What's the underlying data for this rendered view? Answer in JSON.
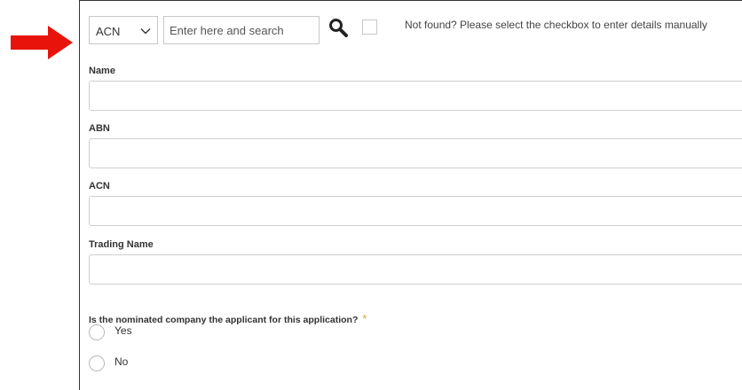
{
  "search": {
    "type_selected": "ACN",
    "placeholder": "Enter here and search",
    "value": "",
    "manual_entry_text": "Not found? Please select the checkbox to enter details manually"
  },
  "fields": [
    {
      "label": "Name",
      "value": ""
    },
    {
      "label": "ABN",
      "value": ""
    },
    {
      "label": "ACN",
      "value": ""
    },
    {
      "label": "Trading Name",
      "value": ""
    }
  ],
  "question": {
    "text": "Is the nominated company the applicant for this application?",
    "required_marker": "*",
    "options": [
      {
        "label": "Yes"
      },
      {
        "label": "No"
      }
    ]
  },
  "colors": {
    "arrow": "#e8140c",
    "required": "#d9a640",
    "border": "#cfcfcf"
  },
  "icons": {
    "search": "magnifier-icon",
    "select": "chevron-down-icon",
    "annotation": "arrow-right-icon"
  }
}
